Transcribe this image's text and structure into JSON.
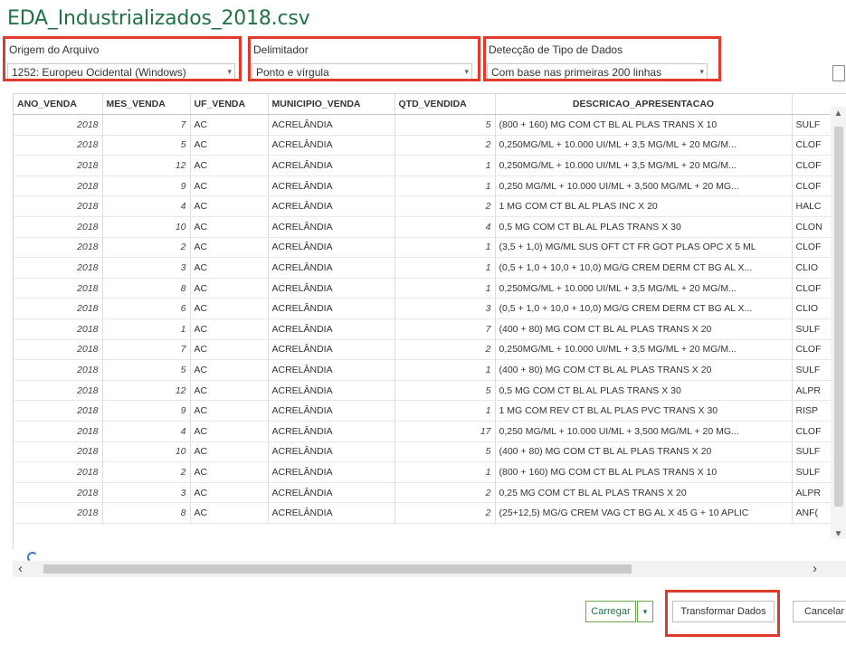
{
  "file_title": "EDA_Industrializados_2018.csv",
  "origin": {
    "label": "Origem do Arquivo",
    "value": "1252: Europeu Ocidental (Windows)"
  },
  "delimiter": {
    "label": "Delimitador",
    "value": "Ponto e vírgula"
  },
  "type_detection": {
    "label": "Detecção de Tipo de Dados",
    "value": "Com base nas primeiras 200 linhas"
  },
  "table": {
    "columns": [
      "ANO_VENDA",
      "MES_VENDA",
      "UF_VENDA",
      "MUNICIPIO_VENDA",
      "QTD_VENDIDA",
      "DESCRICAO_APRESENTACAO",
      ""
    ],
    "rows": [
      [
        "2018",
        "7",
        "AC",
        "ACRELÂNDIA",
        "5",
        "(800 + 160) MG COM CT BL AL PLAS TRANS X 10",
        "SULF"
      ],
      [
        "2018",
        "5",
        "AC",
        "ACRELÂNDIA",
        "2",
        "0,250MG/ML + 10.000 UI/ML + 3,5 MG/ML + 20 MG/M...",
        "CLOF"
      ],
      [
        "2018",
        "12",
        "AC",
        "ACRELÂNDIA",
        "1",
        "0,250MG/ML + 10.000 UI/ML + 3,5 MG/ML + 20 MG/M...",
        "CLOF"
      ],
      [
        "2018",
        "9",
        "AC",
        "ACRELÂNDIA",
        "1",
        "0,250 MG/ML + 10.000 UI/ML + 3,500 MG/ML + 20 MG...",
        "CLOF"
      ],
      [
        "2018",
        "4",
        "AC",
        "ACRELÂNDIA",
        "2",
        "1 MG COM CT BL AL PLAS INC X 20",
        "HALC"
      ],
      [
        "2018",
        "10",
        "AC",
        "ACRELÂNDIA",
        "4",
        "0,5 MG COM CT BL AL PLAS TRANS X 30",
        "CLON"
      ],
      [
        "2018",
        "2",
        "AC",
        "ACRELÂNDIA",
        "1",
        "(3,5 + 1,0) MG/ML SUS OFT CT FR GOT PLAS OPC X 5 ML",
        "CLOF"
      ],
      [
        "2018",
        "3",
        "AC",
        "ACRELÂNDIA",
        "1",
        "(0,5 + 1,0 + 10,0 + 10,0) MG/G CREM DERM CT BG AL X...",
        "CLIO"
      ],
      [
        "2018",
        "8",
        "AC",
        "ACRELÂNDIA",
        "1",
        "0,250MG/ML + 10.000 UI/ML + 3,5 MG/ML + 20 MG/M...",
        "CLOF"
      ],
      [
        "2018",
        "6",
        "AC",
        "ACRELÂNDIA",
        "3",
        "(0,5 + 1,0 + 10,0 + 10,0) MG/G CREM DERM CT BG AL X...",
        "CLIO"
      ],
      [
        "2018",
        "1",
        "AC",
        "ACRELÂNDIA",
        "7",
        "(400 + 80) MG COM CT BL AL PLAS TRANS X 20",
        "SULF"
      ],
      [
        "2018",
        "7",
        "AC",
        "ACRELÂNDIA",
        "2",
        "0,250MG/ML + 10.000 UI/ML + 3,5 MG/ML + 20 MG/M...",
        "CLOF"
      ],
      [
        "2018",
        "5",
        "AC",
        "ACRELÂNDIA",
        "1",
        "(400 + 80) MG COM CT BL AL PLAS TRANS X 20",
        "SULF"
      ],
      [
        "2018",
        "12",
        "AC",
        "ACRELÂNDIA",
        "5",
        "0,5 MG COM CT BL AL PLAS TRANS X 30",
        "ALPR"
      ],
      [
        "2018",
        "9",
        "AC",
        "ACRELÂNDIA",
        "1",
        "1 MG COM REV CT BL AL PLAS PVC TRANS X 30",
        "RISP"
      ],
      [
        "2018",
        "4",
        "AC",
        "ACRELÂNDIA",
        "17",
        "0,250 MG/ML + 10.000 UI/ML + 3,500 MG/ML + 20 MG...",
        "CLOF"
      ],
      [
        "2018",
        "10",
        "AC",
        "ACRELÂNDIA",
        "5",
        "(400 + 80) MG COM CT BL AL PLAS TRANS X 20",
        "SULF"
      ],
      [
        "2018",
        "2",
        "AC",
        "ACRELÂNDIA",
        "1",
        "(800 + 160) MG COM CT BL AL PLAS TRANS X 10",
        "SULF"
      ],
      [
        "2018",
        "3",
        "AC",
        "ACRELÂNDIA",
        "2",
        "0,25 MG COM CT BL AL PLAS TRANS X 20",
        "ALPR"
      ],
      [
        "2018",
        "8",
        "AC",
        "ACRELÂNDIA",
        "2",
        "(25+12,5) MG/G CREM VAG CT BG AL X 45 G + 10 APLIC",
        "ANF("
      ]
    ]
  },
  "buttons": {
    "load": "Carregar",
    "load_dropdown": "▾",
    "transform": "Transformar Dados",
    "cancel": "Cancelar"
  },
  "scroll": {
    "left_arrow": "‹",
    "right_arrow": "›",
    "up_arrow": "▲",
    "down_arrow": "▼"
  },
  "icons": {
    "page": "page-icon",
    "loading": "spinner-icon"
  },
  "colors": {
    "title": "#217346",
    "highlight": "#e03a2c"
  }
}
